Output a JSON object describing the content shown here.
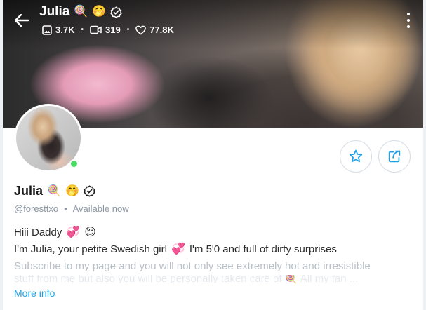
{
  "header": {
    "title": "Julia",
    "title_emojis": [
      "🍭",
      "🤭"
    ],
    "verified_icon": "verified-check-icon",
    "stats": [
      {
        "icon": "photo-icon",
        "value": "3.7K"
      },
      {
        "icon": "video-icon",
        "value": "319"
      },
      {
        "icon": "heart-icon",
        "value": "77.8K"
      }
    ],
    "separator": "•"
  },
  "profile": {
    "name": "Julia",
    "name_emojis": [
      "🍭",
      "🤭"
    ],
    "handle": "@foresttxo",
    "separator": "•",
    "status": "Available now",
    "online": true
  },
  "bio": {
    "line1_text": "Hiii Daddy",
    "line1_emojis": [
      "💞",
      "😌"
    ],
    "line2_a": "I'm Julia, your petite Swedish girl",
    "line2_emoji": "💞",
    "line2_b": "I'm 5'0 and full of dirty surprises",
    "line3": "Subscribe to my page and you will not only see extremely hot and irresistible",
    "line4": "stuff from me but also you will be personally taken care of 🍭 All my fan ..."
  },
  "links": {
    "more_info": "More info"
  },
  "colors": {
    "accent": "#1da1e8",
    "online": "#4cd964",
    "muted": "#8a96a3"
  }
}
